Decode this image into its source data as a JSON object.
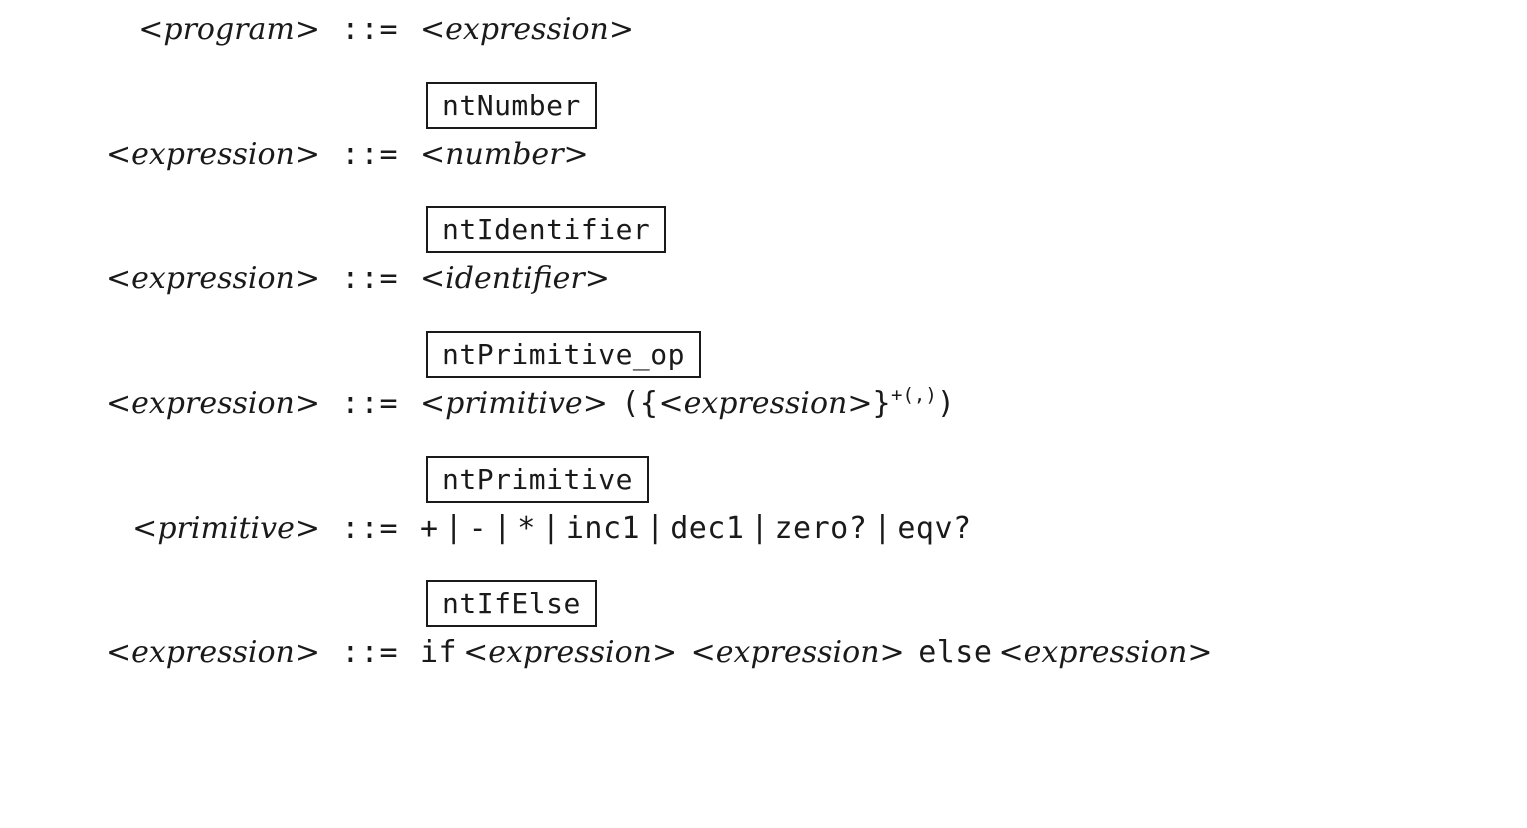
{
  "assign": "::=",
  "bar": "|",
  "super_plus": "+(,)",
  "lhs": {
    "program": "program",
    "expression": "expression",
    "primitive": "primitive"
  },
  "nt": {
    "expression": "expression",
    "number": "number",
    "identifier": "identifier",
    "primitive": "primitive"
  },
  "labels": {
    "ntNumber": "ntNumber",
    "ntIdentifier": "ntIdentifier",
    "ntPrimitive_op": "ntPrimitive_op",
    "ntPrimitive": "ntPrimitive",
    "ntIfElse": "ntIfElse"
  },
  "terminals": {
    "plus": "+",
    "minus": "-",
    "star": "*",
    "inc1": "inc1",
    "dec1": "dec1",
    "zeroq": "zero?",
    "eqvq": "eqv?",
    "lparen": "(",
    "rparen": ")",
    "lbrace": "{",
    "rbrace": "}",
    "if": "if",
    "else": "else"
  },
  "angles": {
    "lt": "<",
    "gt": ">"
  }
}
